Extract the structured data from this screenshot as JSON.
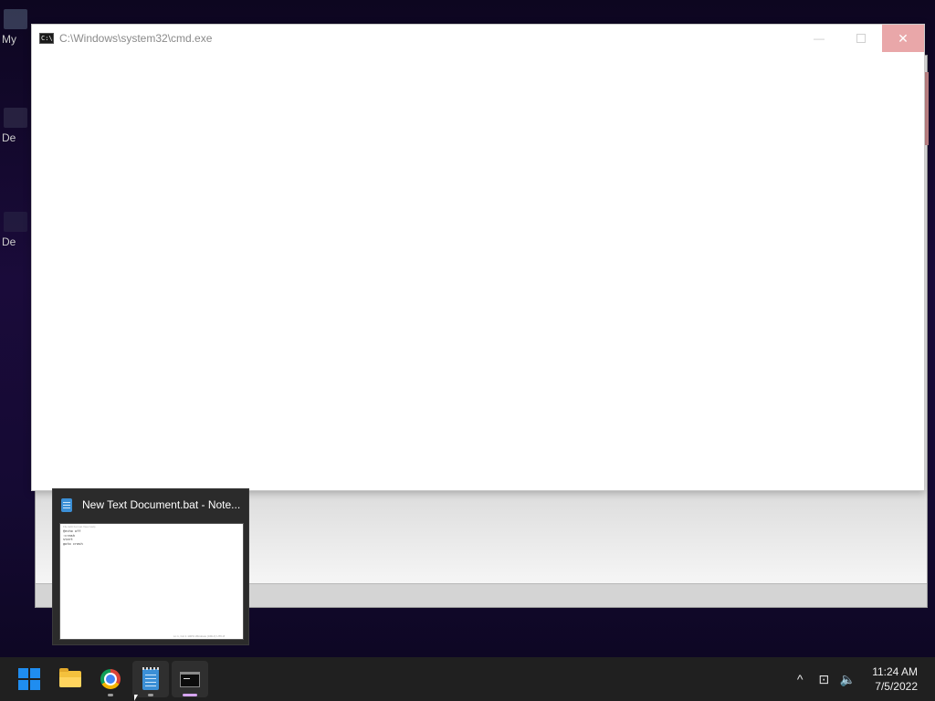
{
  "desktop": {
    "icons": [
      {
        "label": "My"
      },
      {
        "label": "De"
      },
      {
        "label": "De"
      }
    ]
  },
  "cmd_window": {
    "title": "C:\\Windows\\system32\\cmd.exe",
    "icon_text": "C:\\",
    "minimize_symbol": "—",
    "close_symbol": "✕"
  },
  "thumbnail": {
    "title": "New Text Document.bat - Note...",
    "preview_menu": "File  Edit  Format  View  Help",
    "preview_lines": "@echo off\n:crash\nstart\ngoto crash",
    "preview_status": "Ln 1, Col 1      100%    Windows (CRLF)    UTF-8"
  },
  "taskbar": {
    "apps": [
      "start-icon",
      "file-explorer-icon",
      "chrome-icon",
      "notepad-icon",
      "cmd-icon"
    ]
  },
  "tray": {
    "chevron": "^",
    "network": "⊡",
    "volume": "🔈",
    "time": "11:24 AM",
    "date": "7/5/2022"
  }
}
